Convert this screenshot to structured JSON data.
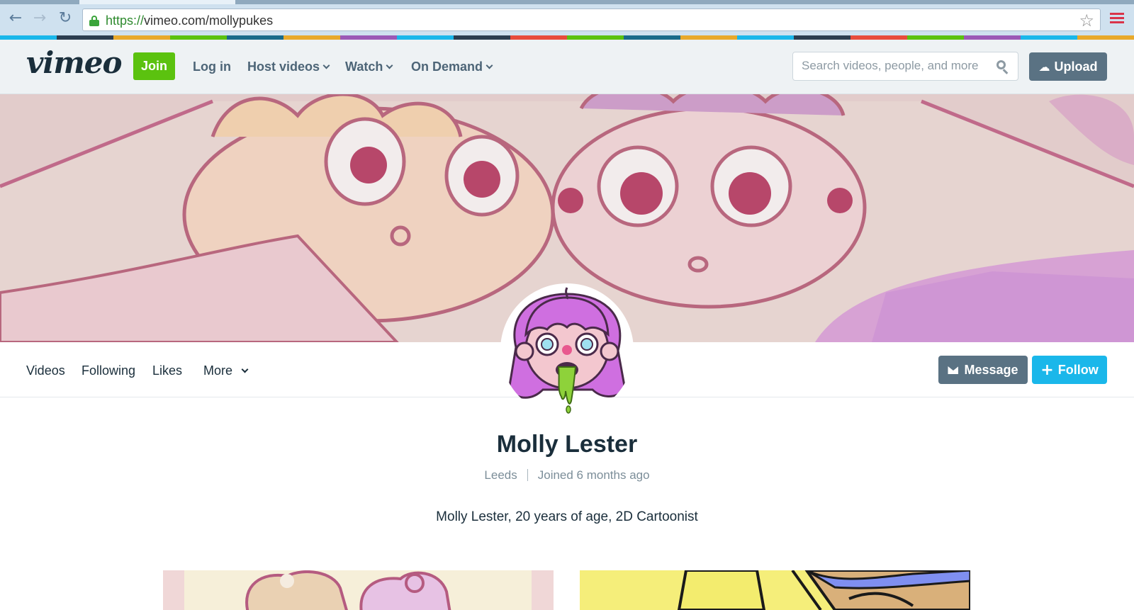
{
  "browser": {
    "url_scheme": "https://",
    "url_rest": "vimeo.com/mollypukes",
    "back_icon": "back-arrow-icon",
    "forward_icon": "forward-arrow-icon",
    "reload_icon": "reload-icon",
    "lock_icon": "lock-icon",
    "bookmark_icon": "star-icon",
    "menu_icon": "hamburger-menu-icon"
  },
  "header": {
    "logo": "vimeo",
    "join_label": "Join",
    "login_label": "Log in",
    "nav": [
      {
        "label": "Host videos"
      },
      {
        "label": "Watch"
      },
      {
        "label": "On Demand"
      }
    ],
    "search_placeholder": "Search videos, people, and more",
    "upload_label": "Upload"
  },
  "profile_nav": {
    "tabs": [
      {
        "label": "Videos"
      },
      {
        "label": "Following"
      },
      {
        "label": "Likes"
      },
      {
        "label": "More"
      }
    ],
    "message_label": "Message",
    "follow_label": "Follow"
  },
  "profile": {
    "name": "Molly Lester",
    "location": "Leeds",
    "joined": "Joined 6 months ago",
    "bio": "Molly Lester, 20 years of age, 2D Cartoonist"
  },
  "colors": {
    "join_green": "#5bc20f",
    "follow_blue": "#1ab7ea",
    "slate_button": "#5a7283",
    "text_dark": "#1a2e3b",
    "text_muted": "#7c8e99"
  }
}
